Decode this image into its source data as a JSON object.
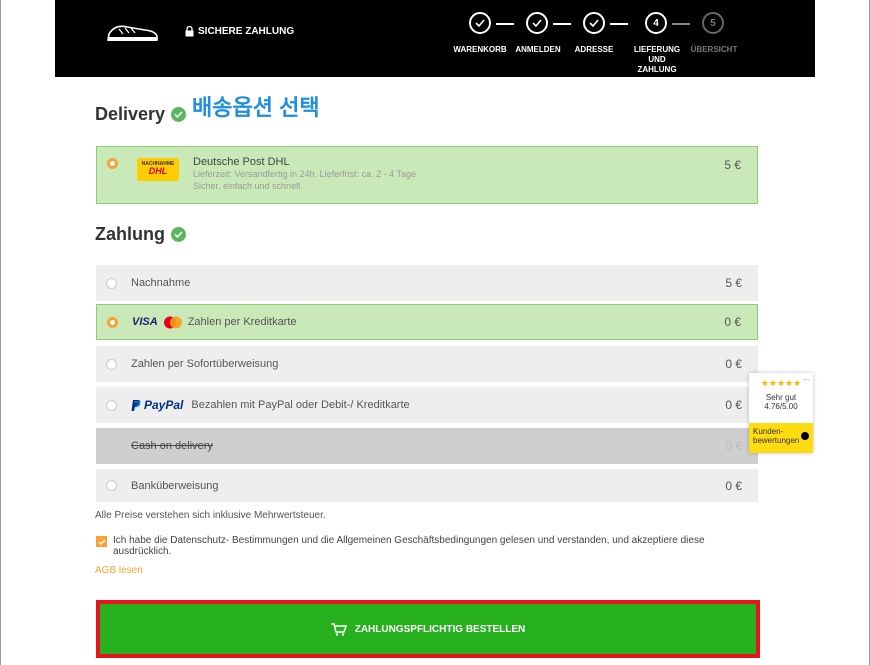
{
  "header": {
    "secure_label": "SICHERE ZAHLUNG",
    "steps": [
      {
        "number": "",
        "label": "WARENKORB",
        "state": "done"
      },
      {
        "number": "",
        "label": "ANMELDEN",
        "state": "done"
      },
      {
        "number": "",
        "label": "ADRESSE",
        "state": "done"
      },
      {
        "number": "4",
        "label": "LIEFERUNG UND ZAHLUNG",
        "state": "current"
      },
      {
        "number": "5",
        "label": "ÜBERSICHT",
        "state": "future"
      }
    ]
  },
  "delivery": {
    "title": "Delivery",
    "annotation": "배송옵션 선택",
    "option": {
      "logo_text": "NACHNAHME",
      "logo_brand": "DHL",
      "name": "Deutsche Post DHL",
      "sub1": "Lieferzeit: Versandfertig in 24h. Lieferfrist: ca. 2 - 4 Tage",
      "sub2": "Sicher, einfach und schnell.",
      "price": "5 €"
    }
  },
  "payment": {
    "title": "Zahlung",
    "options": [
      {
        "label": "Nachnahme",
        "price": "5 €"
      },
      {
        "brand": "VISA",
        "label": "Zahlen per Kreditkarte",
        "price": "0 €"
      },
      {
        "label": "Zahlen per Sofortüberweisung",
        "price": "0 €"
      },
      {
        "brand": "PayPal",
        "label": "Bezahlen mit PayPal oder Debit-/ Kreditkarte",
        "price": "0 €"
      },
      {
        "label": "Cash on delivery",
        "price": "0 €"
      },
      {
        "label": "Banküberweisung",
        "price": "0 €"
      }
    ]
  },
  "footer": {
    "vat_note": "Alle Preise verstehen sich inklusive Mehrwertsteuer.",
    "agree_text": "Ich habe die Datenschutz- Bestimmungen und die Allgemeinen Geschäftsbedingungen gelesen und verstanden, und akzeptiere diese ausdrücklich.",
    "agb_link": "AGB lesen",
    "order_button": "ZAHLUNGSPFLICHTIG BESTELLEN"
  },
  "trust_badge": {
    "stars": "★★★★★",
    "more": "...",
    "rating_text": "Sehr gut",
    "score": "4.76/5.00",
    "label": "Kunden- bewertungen"
  },
  "colors": {
    "accent": "#f7a232",
    "selected_bg": "#c9eab8",
    "order_button": "#26b01e",
    "highlight_border": "#e8141b"
  }
}
